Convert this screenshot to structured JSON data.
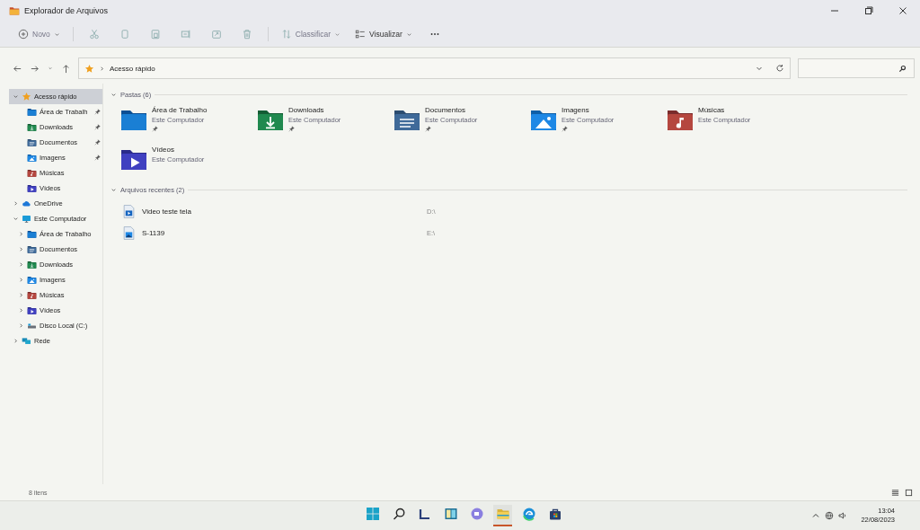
{
  "window": {
    "title": "Explorador de Arquivos"
  },
  "toolbar": {
    "new": "Novo",
    "sort": "Classificar",
    "view": "Visualizar"
  },
  "address": {
    "path": "Acesso rápido"
  },
  "sidebar": {
    "items": [
      {
        "label": "Acesso rápido",
        "kind": "star",
        "expanded": true,
        "selected": true,
        "children": [
          {
            "label": "Área de Trabalh",
            "kind": "desktop",
            "pinned": true,
            "selected": false
          },
          {
            "label": "Downloads",
            "kind": "downloads",
            "pinned": true,
            "selected": false
          },
          {
            "label": "Documentos",
            "kind": "documents",
            "pinned": true,
            "selected": false
          },
          {
            "label": "Imagens",
            "kind": "pictures",
            "pinned": true,
            "selected": false
          },
          {
            "label": "Músicas",
            "kind": "music",
            "pinned": false,
            "selected": false
          },
          {
            "label": "Vídeos",
            "kind": "videos",
            "pinned": false,
            "selected": false
          }
        ]
      },
      {
        "label": "OneDrive",
        "kind": "cloud",
        "expanded": false,
        "selected": false
      },
      {
        "label": "Este Computador",
        "kind": "computer",
        "expanded": true,
        "selected": false,
        "children": [
          {
            "label": "Área de Trabalho",
            "kind": "desktop",
            "expanded": false,
            "selected": false
          },
          {
            "label": "Documentos",
            "kind": "documents",
            "expanded": false,
            "selected": false
          },
          {
            "label": "Downloads",
            "kind": "downloads",
            "expanded": false,
            "selected": false
          },
          {
            "label": "Imagens",
            "kind": "pictures",
            "expanded": false,
            "selected": false
          },
          {
            "label": "Músicas",
            "kind": "music",
            "expanded": false,
            "selected": false
          },
          {
            "label": "Vídeos",
            "kind": "videos",
            "expanded": false,
            "selected": false
          },
          {
            "label": "Disco Local (C:)",
            "kind": "drive",
            "expanded": false,
            "selected": false
          }
        ]
      },
      {
        "label": "Rede",
        "kind": "network",
        "expanded": false,
        "selected": false
      }
    ]
  },
  "folders": {
    "heading": "Pastas (6)",
    "expanded": true,
    "items": [
      {
        "name": "Área de Trabalho",
        "location": "Este Computador",
        "kind": "desktop",
        "pinned": true
      },
      {
        "name": "Downloads",
        "location": "Este Computador",
        "kind": "downloads",
        "pinned": true
      },
      {
        "name": "Documentos",
        "location": "Este Computador",
        "kind": "documents",
        "pinned": true
      },
      {
        "name": "Imagens",
        "location": "Este Computador",
        "kind": "pictures",
        "pinned": true
      },
      {
        "name": "Músicas",
        "location": "Este Computador",
        "kind": "music",
        "pinned": false
      },
      {
        "name": "Vídeos",
        "location": "Este Computador",
        "kind": "videos",
        "pinned": false
      }
    ]
  },
  "recent": {
    "heading": "Arquivos recentes (2)",
    "expanded": true,
    "items": [
      {
        "name": "Video teste tela",
        "path": "D:\\",
        "kind": "video-file"
      },
      {
        "name": "S-1139",
        "path": "E:\\",
        "kind": "image-file"
      }
    ]
  },
  "status_bar": {
    "count": "8 itens"
  },
  "taskbar": {
    "apps": [
      {
        "kind": "start",
        "selected": false
      },
      {
        "kind": "search",
        "selected": false
      },
      {
        "kind": "widgets",
        "selected": false
      },
      {
        "kind": "snap",
        "selected": false
      },
      {
        "kind": "chat",
        "selected": false
      },
      {
        "kind": "explorer",
        "selected": true
      },
      {
        "kind": "browser",
        "selected": false
      },
      {
        "kind": "store",
        "selected": false
      }
    ],
    "time": "13:04",
    "date": "22/08/2023"
  }
}
